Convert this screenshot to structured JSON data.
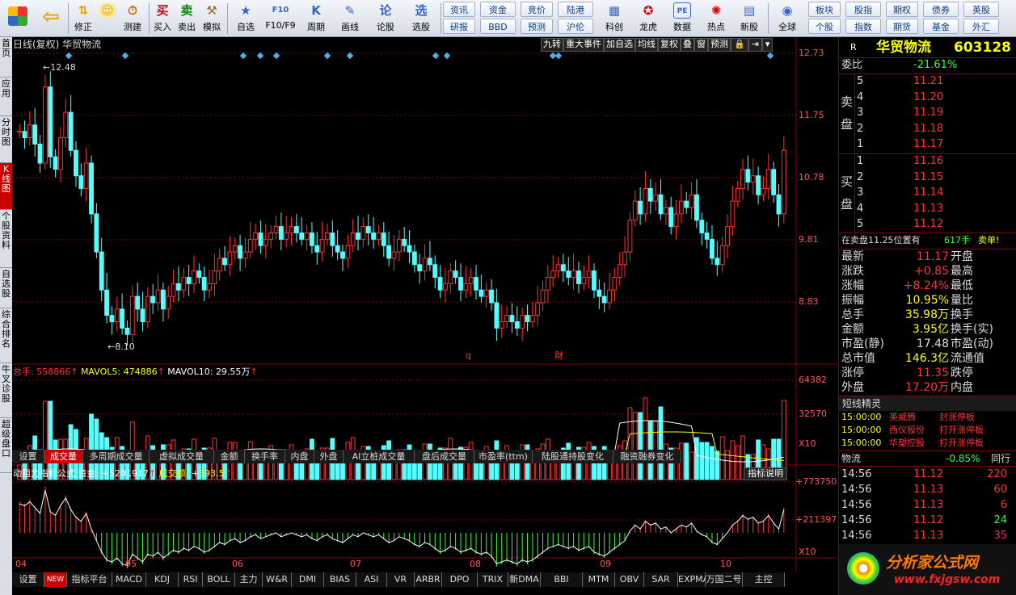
{
  "toolbar": {
    "buttons": [
      "修正",
      "测建",
      "买入",
      "卖出",
      "模拟",
      "自选",
      "F10/F9",
      "周期",
      "画线",
      "论股",
      "选股",
      "全球"
    ],
    "buy_glyph": "买",
    "sell_glyph": "卖",
    "watch_glyph": "★",
    "f10_glyph": "F10",
    "period_glyph": "K",
    "draw_glyph": "✎",
    "discuss_glyph": "论",
    "select_glyph": "选",
    "globe_glyph": "◉",
    "sci_label": "科创",
    "dragon_label": "龙虎",
    "data_label": "数据",
    "hot_label": "热点",
    "new_label": "新股",
    "pe_glyph": "PE",
    "rows_top": [
      "资讯",
      "资金",
      "竞价",
      "陆港"
    ],
    "rows_bottom": [
      "研报",
      "BBD",
      "预测",
      "沪伦"
    ],
    "right_top": [
      "板块",
      "股指",
      "期权",
      "债券",
      "英股"
    ],
    "right_bottom": [
      "个股",
      "指数",
      "期货",
      "基金",
      "外汇"
    ]
  },
  "leftnav": [
    "首页",
    "应用",
    "分时图",
    "K线图",
    "个股资料",
    "自选股",
    "综合排名",
    "牛叉诊股",
    "超级盘口"
  ],
  "chart": {
    "header_title": "日线(复权)  华贸物流",
    "top_tools": [
      "九转",
      "重大事件",
      "加自选",
      "均线",
      "复权",
      "叠",
      "窗",
      "预测"
    ],
    "price_axis": [
      "12.73",
      "11.75",
      "10.78",
      "9.81",
      "8.83"
    ],
    "high_marker": "12.48",
    "low_marker": "8.10",
    "event_q": "q",
    "event_cai": "财",
    "vol_legend": {
      "total_label": "总手:",
      "total": "558866",
      "mavol5_label": "MAVOL5:",
      "mavol5": "474886",
      "mavol10_label": "MAVOL10:",
      "mavol10": "29.55万",
      "arrow": "↑"
    },
    "vol_axis": [
      "64382",
      "32570",
      "X10"
    ],
    "tabs": [
      "设置",
      "成交量",
      "多周期成交量",
      "虚拟成交量",
      "金额",
      "换手率",
      "内盘",
      "外盘",
      "AI立桩成交量",
      "盘后成交量",
      "市盈率(ttm)",
      "陆股通持股变化",
      "融资融券变化"
    ],
    "ind_legend": {
      "name": "动阻力指标公式",
      "fund_label": "资金:",
      "fund": "+5201917",
      "arrow": "↑",
      "amount_label": "成交额:",
      "amount": "+593.5"
    },
    "ind_explain": "指标说明",
    "ind_axis": [
      "+773750",
      "+211397",
      "X10"
    ],
    "months": [
      "04",
      "05",
      "06",
      "07",
      "08",
      "09",
      "10"
    ]
  },
  "bottom_tabs": [
    "设置",
    "NEW",
    "指标平台",
    "MACD",
    "KDJ",
    "RSI",
    "BOLL",
    "主力",
    "W&R",
    "DMI",
    "BIAS",
    "ASI",
    "VR",
    "ARBR",
    "DPO",
    "TRIX",
    "新DMA",
    "BBI",
    "MTM",
    "OBV",
    "SAR",
    "EXPMA",
    "万国二号",
    "主控"
  ],
  "quote": {
    "r_label": "R",
    "name": "华贸物流",
    "code": "603128",
    "weibi_label": "委比",
    "weibi": "-21.61%",
    "sell_label": "卖盘",
    "buy_label": "买盘",
    "asks": [
      {
        "lvl": "5",
        "price": "11.21"
      },
      {
        "lvl": "4",
        "price": "11.20"
      },
      {
        "lvl": "3",
        "price": "11.19"
      },
      {
        "lvl": "2",
        "price": "11.18"
      },
      {
        "lvl": "1",
        "price": "11.17"
      }
    ],
    "bids": [
      {
        "lvl": "1",
        "price": "11.16"
      },
      {
        "lvl": "2",
        "price": "11.15"
      },
      {
        "lvl": "3",
        "price": "11.14"
      },
      {
        "lvl": "4",
        "price": "11.13"
      },
      {
        "lvl": "5",
        "price": "11.12"
      }
    ],
    "notice_text": "在卖盘11.25位置有",
    "notice_vol": "617手",
    "notice_tag": "卖单!",
    "stats": [
      {
        "l1": "最新",
        "v1": "11.17",
        "c1": "r",
        "l2": "开盘"
      },
      {
        "l1": "涨跌",
        "v1": "+0.85",
        "c1": "r",
        "l2": "最高"
      },
      {
        "l1": "涨幅",
        "v1": "+8.24%",
        "c1": "r",
        "l2": "最低"
      },
      {
        "l1": "振幅",
        "v1": "10.95%",
        "c1": "y",
        "l2": "量比"
      },
      {
        "l1": "总手",
        "v1": "35.98万",
        "c1": "y",
        "l2": "换手"
      },
      {
        "l1": "金额",
        "v1": "3.95亿",
        "c1": "y",
        "l2": "换手(实)"
      },
      {
        "l1": "市盈(静)",
        "v1": "17.48",
        "c1": "w",
        "l2": "市盈(动)"
      },
      {
        "l1": "总市值",
        "v1": "146.3亿",
        "c1": "y",
        "l2": "流通值"
      },
      {
        "l1": "涨停",
        "v1": "11.35",
        "c1": "r",
        "l2": "跌停"
      },
      {
        "l1": "外盘",
        "v1": "17.20万",
        "c1": "r",
        "l2": "内盘"
      }
    ],
    "short_title": "短线精灵",
    "short_rows": [
      {
        "time": "15:00:00",
        "stock": "英威腾",
        "event": "封涨停板"
      },
      {
        "time": "15:00:00",
        "stock": "西仪股份",
        "event": "打开涨停板"
      },
      {
        "time": "15:00:00",
        "stock": "华塑控股",
        "event": "打开涨停板"
      }
    ],
    "sector_name": "物流",
    "sector_chg": "-0.85%",
    "sector_same": "同行",
    "ticks": [
      {
        "time": "14:56",
        "price": "11.12",
        "vol": "220",
        "c": "r"
      },
      {
        "time": "14:56",
        "price": "11.13",
        "vol": "60",
        "c": "r"
      },
      {
        "time": "14:56",
        "price": "11.13",
        "vol": "6",
        "c": "r"
      },
      {
        "time": "14:56",
        "price": "11.12",
        "vol": "24",
        "c": "g"
      },
      {
        "time": "14:56",
        "price": "11.13",
        "vol": "35",
        "c": "r"
      }
    ],
    "watermark": "分析家公式网",
    "watermark_url": "www.fxjgsw.com"
  },
  "colors": {
    "up": "#ff3333",
    "down": "#54ffff",
    "bg": "#000000",
    "grid": "#8b0000",
    "ma5": "#ffffff",
    "ma10": "#ffff00"
  }
}
